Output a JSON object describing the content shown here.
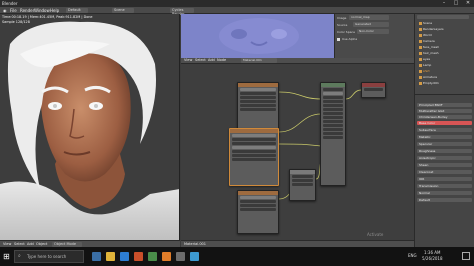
{
  "window": {
    "title": "Blender",
    "minimize": "–",
    "maximize": "□",
    "close": "✕"
  },
  "menubar": {
    "items": [
      "File",
      "Render",
      "Window",
      "Help"
    ],
    "layout": "Default",
    "scene": "Scene",
    "engine": "Cycles Render"
  },
  "viewport": {
    "info_lines": [
      "Time:00:18.19 | Mem:401.45M, Peak:911.82M | Done",
      "Sample 128/128"
    ],
    "header_items": [
      "View",
      "Select",
      "Add",
      "Object",
      "Object Mode"
    ]
  },
  "image_panel": {
    "fields": [
      "Image",
      "normal_map",
      "Source",
      "Generated",
      "Color Space",
      "Non-Color",
      "Use Alpha"
    ]
  },
  "node_editor": {
    "header_items": [
      "View",
      "Select",
      "Add",
      "Node",
      "Material.001"
    ],
    "footer_label": "Material.001",
    "activate_text": "Activate"
  },
  "outliner": {
    "search_placeholder": "",
    "rows": [
      "Scene",
      "RenderLayers",
      "World",
      "Camera",
      "face_mesh",
      "hair_mesh",
      "eyes",
      "Lamp",
      "shirt",
      "Armature",
      "Empty.001"
    ]
  },
  "properties": {
    "rows": [
      {
        "label": "Principled BSDF"
      },
      {
        "label": "Multiscatter GGX"
      },
      {
        "label": "Christensen-Burley"
      },
      {
        "label": "Base Color"
      },
      {
        "label": "Subsurface"
      },
      {
        "label": "Metallic"
      },
      {
        "label": "Specular"
      },
      {
        "label": "Roughness"
      },
      {
        "label": "Anisotropic"
      },
      {
        "label": "Sheen"
      },
      {
        "label": "Clearcoat"
      },
      {
        "label": "IOR"
      },
      {
        "label": "Transmission"
      },
      {
        "label": "Normal"
      },
      {
        "label": "Default"
      }
    ]
  },
  "taskbar": {
    "search_text": "Type here to search",
    "time": "1:36 AM",
    "date": "5/26/2018",
    "lang": "ENG"
  },
  "colors": {
    "accent": "#d08a3a",
    "image_bg": "#7d84c9",
    "base_color_swatch": "#d85555"
  }
}
